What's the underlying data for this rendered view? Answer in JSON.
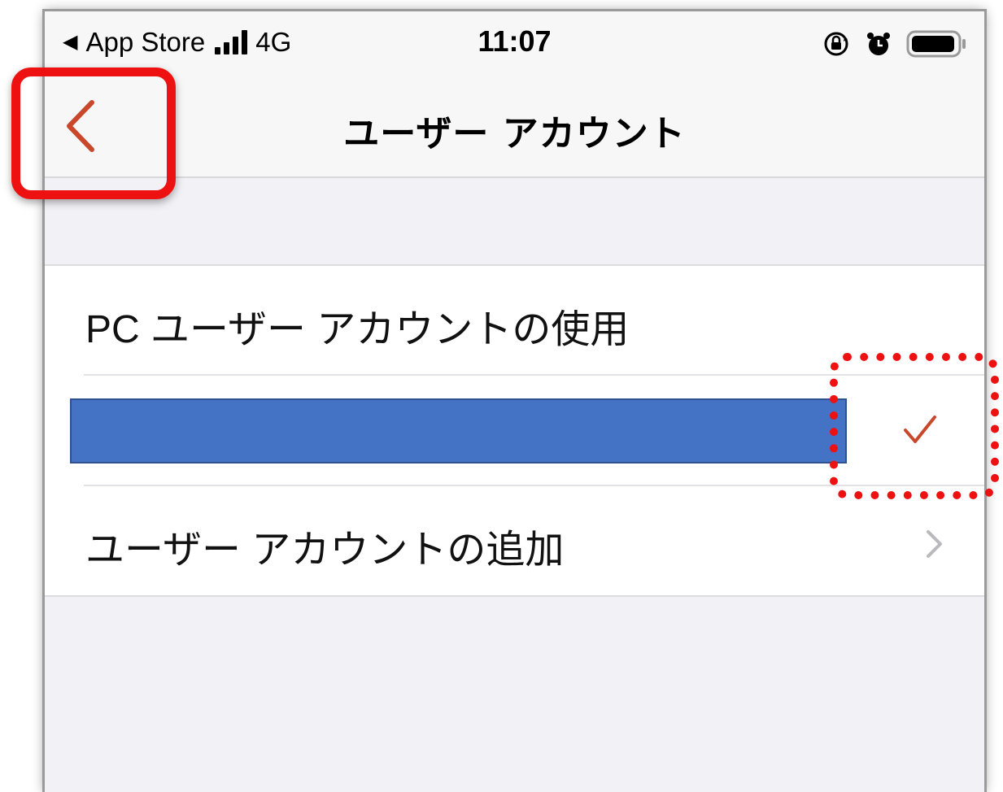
{
  "status_bar": {
    "back_app": "App Store",
    "network": "4G",
    "time": "11:07",
    "icons": [
      "back-triangle-icon",
      "signal-bars-icon",
      "rotation-lock-icon",
      "alarm-icon",
      "battery-icon"
    ]
  },
  "nav": {
    "title": "ユーザー アカウント",
    "back_icon": "chevron-left-icon",
    "accent_color": "#c9482b"
  },
  "rows": {
    "use_pc_account": "PC ユーザー アカウントの使用",
    "selected_account": {
      "redacted": true,
      "checked": true,
      "check_icon": "checkmark-icon",
      "redaction_color": "#4472c4"
    },
    "add_account": "ユーザー アカウントの追加",
    "add_account_icon": "chevron-right-icon"
  },
  "annotations": {
    "highlight_color": "#ee1111",
    "back_button_highlight": "solid-rounded-rectangle",
    "checkmark_highlight": "dotted-rounded-rectangle"
  }
}
